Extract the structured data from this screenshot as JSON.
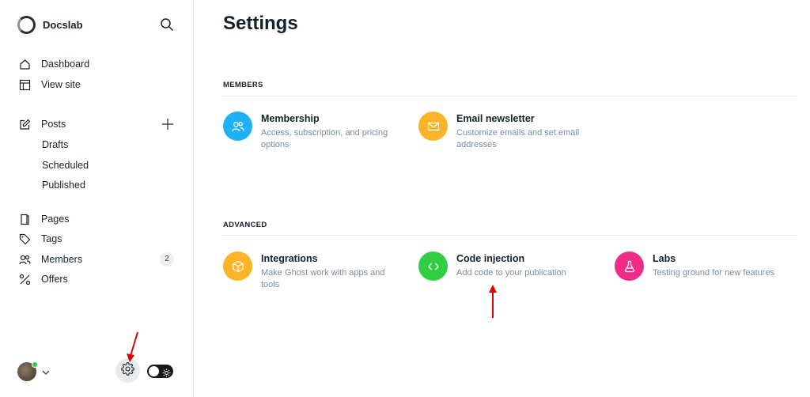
{
  "brand": {
    "name": "Docslab"
  },
  "sidebar": {
    "nav_top": [
      {
        "label": "Dashboard"
      },
      {
        "label": "View site"
      }
    ],
    "posts": {
      "label": "Posts",
      "sub": [
        {
          "label": "Drafts"
        },
        {
          "label": "Scheduled"
        },
        {
          "label": "Published"
        }
      ]
    },
    "nav_bottom": [
      {
        "label": "Pages"
      },
      {
        "label": "Tags"
      },
      {
        "label": "Members",
        "count": "2"
      },
      {
        "label": "Offers"
      }
    ]
  },
  "main": {
    "title": "Settings",
    "sections": [
      {
        "label": "MEMBERS",
        "cards": [
          {
            "title": "Membership",
            "desc_line1": "Access, subscription, and pricing",
            "desc_line2": "options",
            "color": "#1eb2f5",
            "icon": "members-icon"
          },
          {
            "title": "Email newsletter",
            "desc_line1": "Customize emails and set email",
            "desc_line2": "addresses",
            "color": "#fbb427",
            "icon": "mail-icon"
          }
        ]
      },
      {
        "label": "ADVANCED",
        "cards": [
          {
            "title": "Integrations",
            "desc_line1": "Make Ghost work with apps and",
            "desc_line2": "tools",
            "color": "#fbb427",
            "icon": "box-icon"
          },
          {
            "title": "Code injection",
            "desc_line1": "Add code to your publication",
            "desc_line2": "",
            "color": "#30cf43",
            "icon": "code-icon"
          },
          {
            "title": "Labs",
            "desc_line1": "Testing ground for new features",
            "desc_line2": "",
            "color": "#f02b89",
            "icon": "flask-icon"
          }
        ]
      }
    ]
  },
  "colors": {
    "annotation_arrow": "#e00000",
    "text": "#15212a",
    "muted": "#7c8b9a"
  }
}
